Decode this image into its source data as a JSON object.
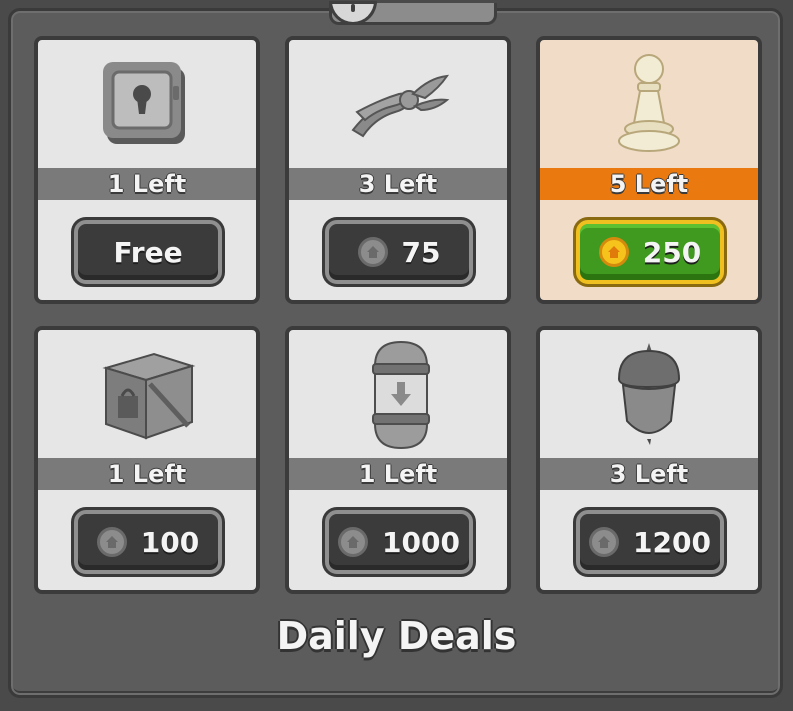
{
  "header": {
    "title": "Daily Deals"
  },
  "colors": {
    "featured_card_bg": "#f0dcc7",
    "featured_bar": "#ea7a10",
    "featured_button": "#3f9a1f",
    "featured_button_border": "#f0c020",
    "selection_highlight": "#0a4fd0",
    "disabled_gray": "#7a7a7a"
  },
  "deals": [
    {
      "item_icon": "safe-icon",
      "left": "1 Left",
      "price": "Free",
      "has_coin": false,
      "featured": false
    },
    {
      "item_icon": "pliers-icon",
      "left": "3 Left",
      "price": "75",
      "has_coin": true,
      "featured": false
    },
    {
      "item_icon": "pawn-icon",
      "left": "5 Left",
      "price": "250",
      "has_coin": true,
      "featured": true
    },
    {
      "item_icon": "crate-icon",
      "left": "1 Left",
      "price": "100",
      "has_coin": true,
      "featured": false
    },
    {
      "item_icon": "capsule-icon",
      "left": "1 Left",
      "price": "1000",
      "has_coin": true,
      "featured": false
    },
    {
      "item_icon": "acorn-icon",
      "left": "3 Left",
      "price": "1200",
      "has_coin": true,
      "featured": false
    }
  ]
}
